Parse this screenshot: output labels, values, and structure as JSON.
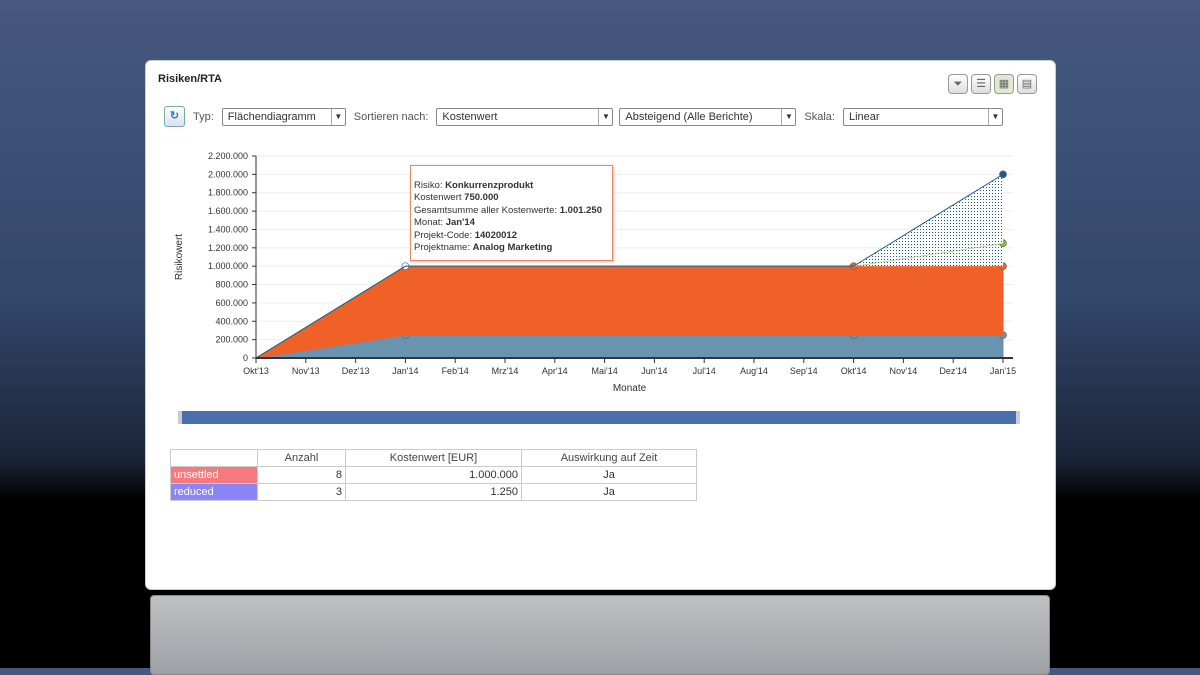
{
  "panel": {
    "title": "Risiken/RTA",
    "icons": [
      "filter-icon",
      "list-icon",
      "chart-icon",
      "grid-icon"
    ]
  },
  "toolbar": {
    "typ_label": "Typ:",
    "typ_value": "Flächendiagramm",
    "sort_label": "Sortieren nach:",
    "sort_value": "Kostenwert",
    "order_value": "Absteigend (Alle Berichte)",
    "scale_label": "Skala:",
    "scale_value": "Linear"
  },
  "tooltip": {
    "l1": "Risiko: ",
    "v1": "Konkurrenzprodukt",
    "l2": "Kostenwert ",
    "v2": "750.000",
    "l3": "Gesamtsumme aller Kostenwerte: ",
    "v3": "1.001.250",
    "l4": "Monat: ",
    "v4": "Jan'14",
    "l5": "Projekt-Code: ",
    "v5": "14020012",
    "l6": "Projektname: ",
    "v6": "Analog Marketing"
  },
  "chart_data": {
    "type": "area",
    "stacked": true,
    "xlabel": "Monate",
    "ylabel": "Risikowert",
    "ylim": [
      0,
      2200000
    ],
    "yticks": [
      "0",
      "200.000",
      "400.000",
      "600.000",
      "800.000",
      "1.000.000",
      "1.200.000",
      "1.400.000",
      "1.600.000",
      "1.800.000",
      "2.000.000",
      "2.200.000"
    ],
    "categories": [
      "Okt'13",
      "Nov'13",
      "Dez'13",
      "Jan'14",
      "Feb'14",
      "Mrz'14",
      "Apr'14",
      "Mai'14",
      "Jun'14",
      "Jul'14",
      "Aug'14",
      "Sep'14",
      "Okt'14",
      "Nov'14",
      "Dez'14",
      "Jan'15"
    ],
    "series": [
      {
        "color": "#6a93b0",
        "values": [
          0,
          83333,
          166667,
          250000,
          250000,
          250000,
          250000,
          250000,
          250000,
          250000,
          250000,
          250000,
          250000,
          250000,
          250000,
          250000
        ]
      },
      {
        "color": "#f06128",
        "values": [
          0,
          250000,
          500000,
          750000,
          750000,
          750000,
          750000,
          750000,
          750000,
          750000,
          750000,
          750000,
          750000,
          750000,
          750000,
          750000
        ]
      },
      {
        "color": "#8cb83a",
        "values": [
          0,
          0,
          0,
          0,
          0,
          0,
          0,
          0,
          0,
          0,
          0,
          0,
          0,
          83333,
          166667,
          250000
        ]
      },
      {
        "color": "#1e5b8c",
        "values": [
          0,
          0,
          0,
          0,
          0,
          0,
          0,
          0,
          0,
          0,
          0,
          0,
          0,
          250000,
          500000,
          750000
        ]
      }
    ],
    "markers_at": [
      3,
      12,
      15
    ]
  },
  "table": {
    "headers": [
      "",
      "Anzahl",
      "Kostenwert [EUR]",
      "Auswirkung auf Zeit"
    ],
    "rows": [
      {
        "label": "unsettled",
        "color": "#f57a80",
        "count": "8",
        "value": "1.000.000",
        "impact": "Ja"
      },
      {
        "label": "reduced",
        "color": "#8a86f8",
        "count": "3",
        "value": "1.250",
        "impact": "Ja"
      }
    ]
  }
}
